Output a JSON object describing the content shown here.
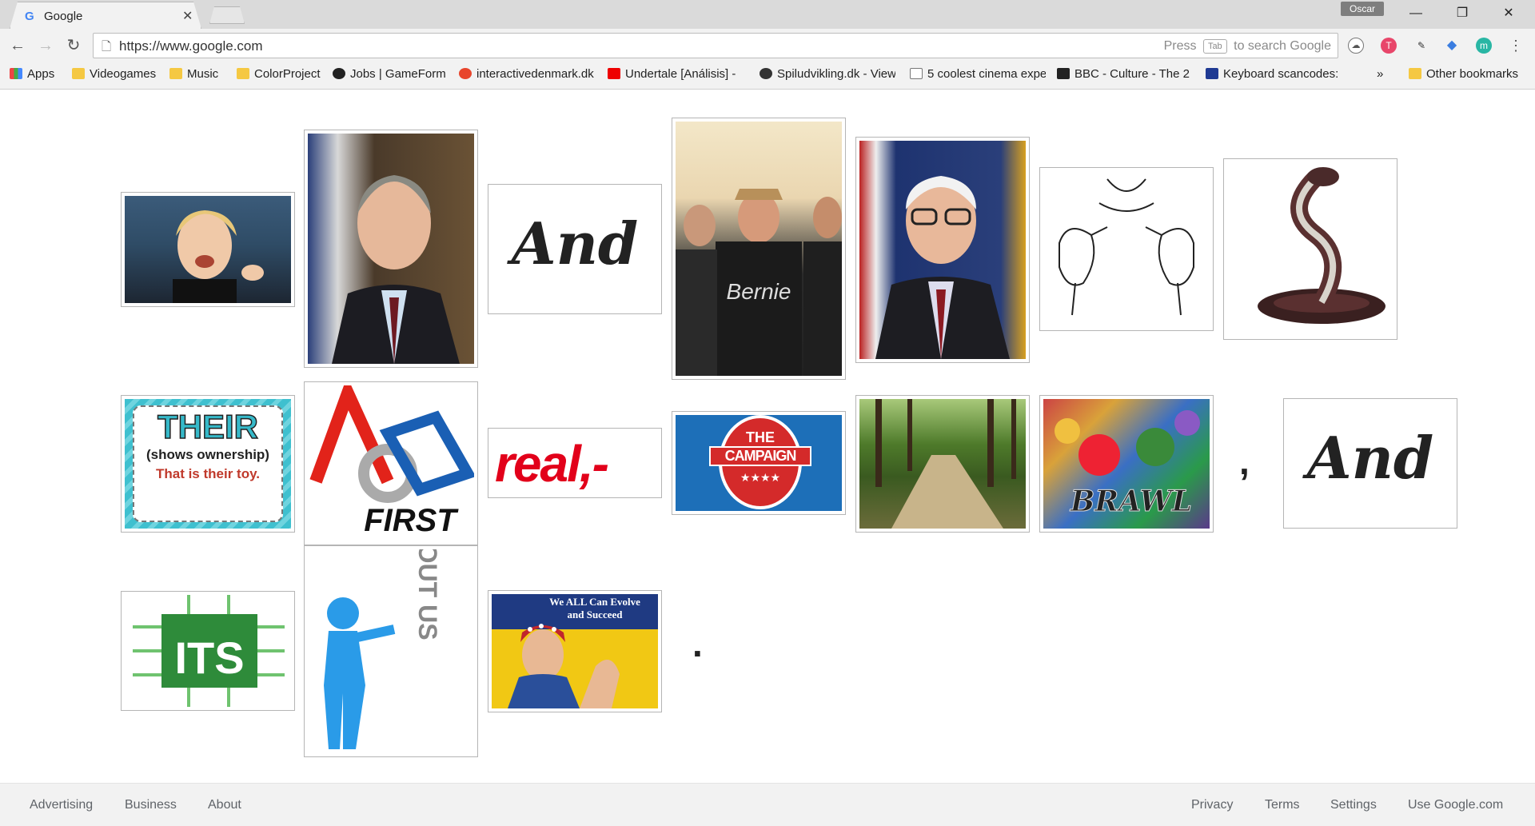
{
  "browser": {
    "tab_title": "Google",
    "tab_favicon": "G",
    "profile_name": "Oscar",
    "url": "https://www.google.com",
    "omnibox_hint_prefix": "Press",
    "omnibox_hint_key": "Tab",
    "omnibox_hint_suffix": "to search Google"
  },
  "bookmarks": [
    {
      "label": "Apps"
    },
    {
      "label": "Videogames"
    },
    {
      "label": "Music"
    },
    {
      "label": "ColorProject"
    },
    {
      "label": "Jobs | GameForm"
    },
    {
      "label": "interactivedenmark.dk"
    },
    {
      "label": "Undertale [Análisis] - "
    },
    {
      "label": "Spiludvikling.dk - View"
    },
    {
      "label": "5 coolest cinema expe"
    },
    {
      "label": "BBC - Culture - The 2"
    },
    {
      "label": "Keyboard scancodes:"
    },
    {
      "label": "»"
    },
    {
      "label": "Other bookmarks"
    }
  ],
  "content": {
    "and_word": "And",
    "first_text": "FIRST",
    "real_text": "real,-",
    "campaign_the": "THE",
    "campaign_word": "CAMPAIGN",
    "campaign_stars": "★★★★",
    "bernie_title": "Bernie",
    "their_word": "THEIR",
    "their_sub": "(shows ownership)",
    "their_example": "That is their toy.",
    "its_text": "ITS",
    "about_letters": "ABOUT US",
    "rosie_caption_line1": "We ALL Can Evolve",
    "rosie_caption_line2": "and Succeed",
    "brawl_text": "BRAWL",
    "comma": ",",
    "period": "."
  },
  "footer": {
    "left": [
      "Advertising",
      "Business",
      "About"
    ],
    "right": [
      "Privacy",
      "Terms",
      "Settings",
      "Use Google.com"
    ]
  },
  "colors": {
    "first_red": "#e2231a",
    "first_blue": "#1a5fb4",
    "real_red": "#e2001a",
    "campaign_blue": "#1d6fb8",
    "its_green": "#2e8b3a",
    "their_teal": "#36b9c9"
  }
}
